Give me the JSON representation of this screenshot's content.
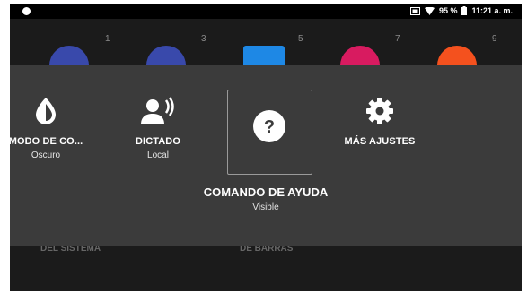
{
  "status": {
    "battery_percent": "95 %",
    "time": "11:21 a. m.",
    "icons": [
      "notification-dot-icon",
      "sim-icon",
      "wifi-icon",
      "battery-icon"
    ]
  },
  "background": {
    "numbers": [
      "1",
      "3",
      "5",
      "7",
      "9"
    ],
    "labels": [
      "DEL SISTEMA",
      "DE BARRAS"
    ],
    "icon_colors": [
      "#3949ab",
      "#3949ab",
      "#1e88e5",
      "#d81b60",
      "#f4511e"
    ]
  },
  "menu": {
    "items": [
      {
        "icon": "contrast-icon",
        "title": "MODO DE CO...",
        "subtitle": "Oscuro"
      },
      {
        "icon": "dictation-icon",
        "title": "DICTADO",
        "subtitle": "Local"
      },
      {
        "icon": "help-icon",
        "title": "COMANDO DE AYUDA",
        "subtitle": "Visible"
      },
      {
        "icon": "gear-icon",
        "title": "MÁS AJUSTES",
        "subtitle": ""
      }
    ]
  },
  "colors": {
    "overlay": "#3b3b3b",
    "screen": "#1b1b1b",
    "statusbar": "#000000"
  }
}
